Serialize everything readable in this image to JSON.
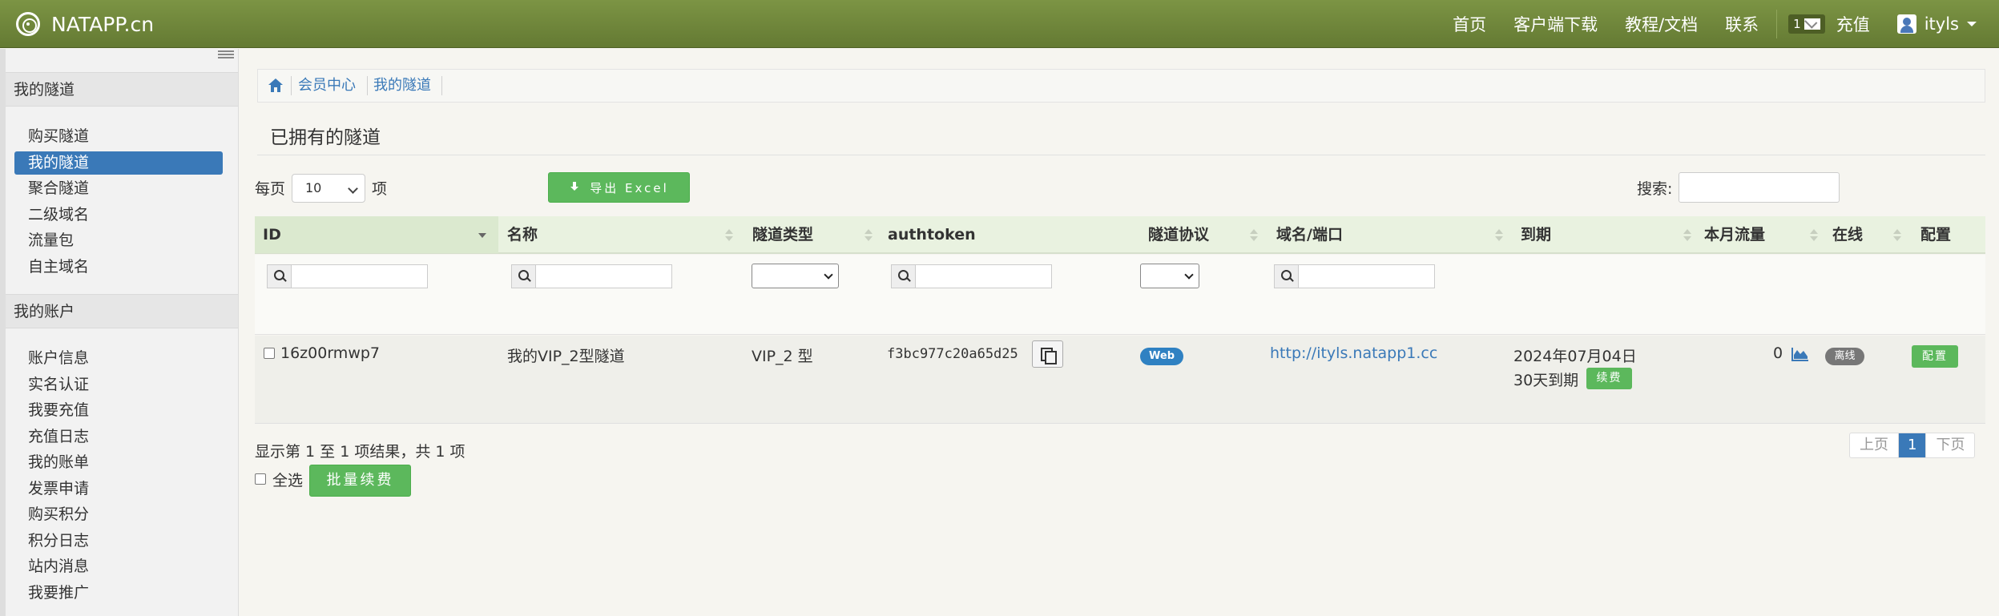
{
  "navbar": {
    "brand": "NATAPP.cn",
    "links": [
      "首页",
      "客户端下载",
      "教程/文档",
      "联系"
    ],
    "message_count": "1",
    "recharge": "充值",
    "username": "ityls"
  },
  "sidebar": {
    "sections": [
      {
        "title": "我的隧道",
        "items": [
          "购买隧道",
          "我的隧道",
          "聚合隧道",
          "二级域名",
          "流量包",
          "自主域名"
        ]
      },
      {
        "title": "我的账户",
        "items": [
          "账户信息",
          "实名认证",
          "我要充值",
          "充值日志",
          "我的账单",
          "发票申请",
          "购买积分",
          "积分日志",
          "站内消息",
          "我要推广"
        ]
      }
    ],
    "active_item": "我的隧道"
  },
  "breadcrumb": [
    "会员中心",
    "我的隧道"
  ],
  "page_title": "已拥有的隧道",
  "toolbar": {
    "per_page_label": "每页",
    "per_page_value": "10",
    "per_page_unit": "项",
    "export_label": "导出 Excel",
    "search_label": "搜索:"
  },
  "table": {
    "columns": [
      "ID",
      "名称",
      "隧道类型",
      "authtoken",
      "隧道协议",
      "域名/端口",
      "到期",
      "本月流量",
      "在线",
      "配置"
    ],
    "rows": [
      {
        "id": "16z00rmwp7",
        "name": "我的VIP_2型隧道",
        "type": "VIP_2 型",
        "authtoken": "f3bc977c20a65d25",
        "protocol": "Web",
        "domain": "http://ityls.natapp1.cc",
        "expire_date": "2024年07月04日",
        "expire_days": "30天到期",
        "renew": "续费",
        "traffic": "0",
        "online": "离线",
        "config": "配置"
      }
    ]
  },
  "footer": {
    "info": "显示第 1 至 1 项结果，共 1 项",
    "select_all": "全选",
    "batch_renew": "批量续费",
    "pager": {
      "prev": "上页",
      "current": "1",
      "next": "下页"
    }
  }
}
